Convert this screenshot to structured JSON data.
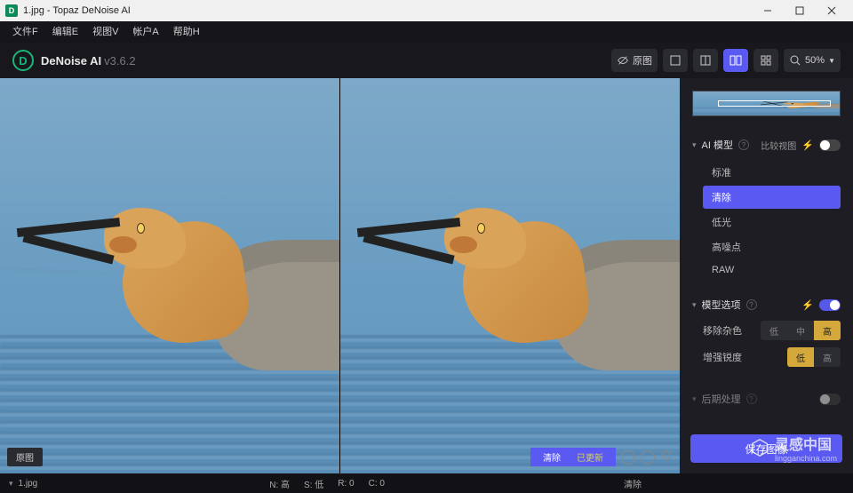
{
  "window": {
    "title": "1.jpg - Topaz DeNoise AI"
  },
  "menu": {
    "file": "文件F",
    "edit": "编辑E",
    "view": "视图V",
    "account": "帐户A",
    "help": "帮助H"
  },
  "header": {
    "product": "DeNoise AI",
    "version": "v3.6.2",
    "original_btn": "原图",
    "zoom_icon": "search",
    "zoom_value": "50%"
  },
  "viewer": {
    "left_label": "原图",
    "right_label": "清除",
    "right_status": "已更新"
  },
  "panel": {
    "section_model": "AI 模型",
    "compare_view": "比较视图",
    "modes": {
      "standard": "标准",
      "clear": "清除",
      "lowlight": "低光",
      "severe": "高噪点",
      "raw": "RAW",
      "selected": "clear"
    },
    "section_options": "模型选项",
    "remove_noise": {
      "label": "移除杂色",
      "options": [
        "低",
        "中",
        "高"
      ],
      "selected": "高"
    },
    "enhance_sharp": {
      "label": "增强锐度",
      "options": [
        "低",
        "高"
      ],
      "selected": "低"
    },
    "post_proc": "后期处理",
    "save_btn": "保存图像"
  },
  "bottom": {
    "filename": "1.jpg",
    "stats": {
      "n": "N: 高",
      "s": "S: 低",
      "r": "R: 0",
      "c": "C: 0"
    },
    "model": "清除"
  },
  "watermark": {
    "text": "灵感中国",
    "sub": "lingganchina.com"
  }
}
